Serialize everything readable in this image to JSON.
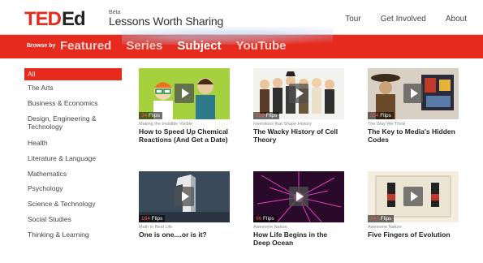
{
  "header": {
    "logo_ted": "TED",
    "logo_ed": "Ed",
    "beta": "Beta",
    "tagline": "Lessons Worth Sharing",
    "nav": [
      "Tour",
      "Get Involved",
      "About"
    ]
  },
  "browse": {
    "label": "Browse by",
    "tabs": [
      "Featured",
      "Series",
      "Subject",
      "YouTube"
    ],
    "active_tab": "Subject"
  },
  "sidebar": {
    "items": [
      {
        "label": "All"
      },
      {
        "label": "The Arts"
      },
      {
        "label": "Business & Economics"
      },
      {
        "label": "Design, Engineering & Technology"
      },
      {
        "label": "Health"
      },
      {
        "label": "Literature & Language"
      },
      {
        "label": "Mathematics"
      },
      {
        "label": "Psychology"
      },
      {
        "label": "Science & Technology"
      },
      {
        "label": "Social Studies"
      },
      {
        "label": "Thinking & Learning"
      }
    ],
    "active": "All"
  },
  "cards": [
    {
      "flips": "34",
      "flips_label": "Flips",
      "series": "Making the Invisible Visible",
      "title": "How to Speed Up Chemical Reactions (And Get a Date)"
    },
    {
      "flips": "109",
      "flips_label": "Flips",
      "series": "Inventions that Shape History",
      "title": "The Wacky History of Cell Theory"
    },
    {
      "flips": "114",
      "flips_label": "Flips",
      "series": "The Way We Think",
      "title": "The Key to Media's Hidden Codes"
    },
    {
      "flips": "164",
      "flips_label": "Flips",
      "series": "Math in Real Life",
      "title": "One is one....or is it?"
    },
    {
      "flips": "96",
      "flips_label": "Flips",
      "series": "Awesome Nature",
      "title": "How Life Begins in the Deep Ocean"
    },
    {
      "flips": "147",
      "flips_label": "Flips",
      "series": "Awesome Nature",
      "title": "Five Fingers of Evolution"
    }
  ],
  "colors": {
    "brand_red": "#e62b1e"
  }
}
